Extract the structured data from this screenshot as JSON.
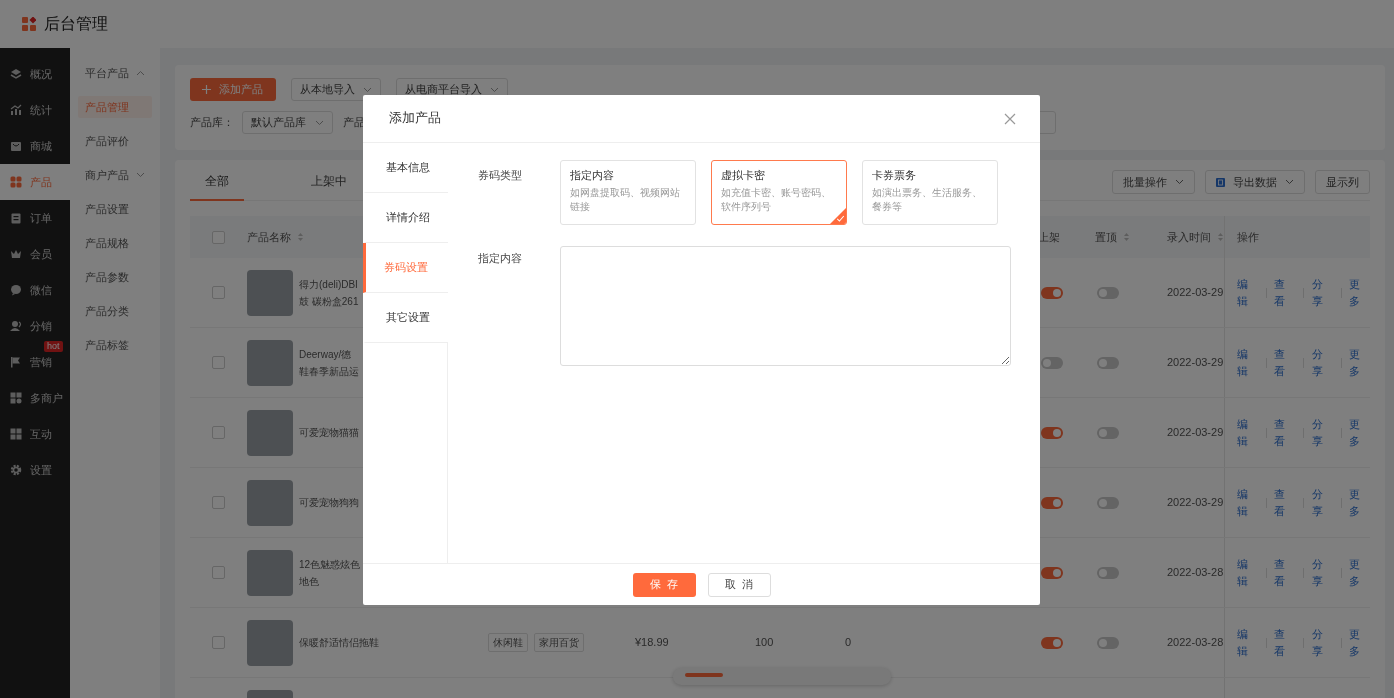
{
  "header": {
    "title": "后台管理"
  },
  "sidebar": {
    "items": [
      {
        "label": "概况",
        "selected": false
      },
      {
        "label": "统计",
        "selected": false
      },
      {
        "label": "商城",
        "selected": false
      },
      {
        "label": "产品",
        "selected": true
      },
      {
        "label": "订单",
        "selected": false
      },
      {
        "label": "会员",
        "selected": false
      },
      {
        "label": "微信",
        "selected": false
      },
      {
        "label": "分销",
        "selected": false
      },
      {
        "label": "营销",
        "selected": false,
        "badge": "hot"
      },
      {
        "label": "多商户",
        "selected": false
      },
      {
        "label": "互动",
        "selected": false
      },
      {
        "label": "设置",
        "selected": false
      }
    ]
  },
  "subnav": {
    "items": [
      {
        "label": "平台产品",
        "kind": "group",
        "expanded": true
      },
      {
        "label": "产品管理",
        "kind": "link",
        "selected": true
      },
      {
        "label": "产品评价",
        "kind": "link",
        "selected": false
      },
      {
        "label": "商户产品",
        "kind": "group",
        "expanded": false
      },
      {
        "label": "产品设置",
        "kind": "link",
        "selected": false
      },
      {
        "label": "产品规格",
        "kind": "link",
        "selected": false
      },
      {
        "label": "产品参数",
        "kind": "link",
        "selected": false
      },
      {
        "label": "产品分类",
        "kind": "link",
        "selected": false
      },
      {
        "label": "产品标签",
        "kind": "link",
        "selected": false
      }
    ]
  },
  "toolbar": {
    "add_button": "添加产品",
    "import_buttons": [
      "从本地导入",
      "从电商平台导入"
    ],
    "filters": [
      {
        "label": "产品库：",
        "value": "默认产品库"
      },
      {
        "label": "产品"
      }
    ]
  },
  "table": {
    "tabs": [
      {
        "label": "全部",
        "selected": true
      },
      {
        "label": "上架中",
        "selected": false
      }
    ],
    "actions": [
      "批量操作",
      "导出数据",
      "显示列"
    ],
    "select_all_checked": false,
    "columns": [
      {
        "label": "产品名称",
        "sortable": true
      },
      {
        "label": "上架",
        "sortable": false
      },
      {
        "label": "置顶",
        "sortable": true
      },
      {
        "label": "录入时间",
        "sortable": true
      },
      {
        "label": "操作",
        "sortable": false
      }
    ],
    "rows": [
      {
        "name_lines": [
          "得力(deli)DBI",
          "鼓 碳粉盒261"
        ],
        "checked": false,
        "on_shelf": true,
        "pinned": false,
        "date": "2022-03-29",
        "actions": [
          "编辑",
          "查看",
          "分享",
          "更多"
        ]
      },
      {
        "name_lines": [
          "Deerway/德",
          "鞋春季新品运"
        ],
        "checked": false,
        "on_shelf": false,
        "pinned": false,
        "date": "2022-03-29",
        "actions": [
          "编辑",
          "查看",
          "分享",
          "更多"
        ]
      },
      {
        "name_lines": [
          "可爱宠物猫猫"
        ],
        "checked": false,
        "on_shelf": true,
        "pinned": false,
        "date": "2022-03-29",
        "actions": [
          "编辑",
          "查看",
          "分享",
          "更多"
        ]
      },
      {
        "name_lines": [
          "可爱宠物狗狗"
        ],
        "checked": false,
        "on_shelf": true,
        "pinned": false,
        "date": "2022-03-29",
        "actions": [
          "编辑",
          "查看",
          "分享",
          "更多"
        ]
      },
      {
        "name_lines": [
          "12色魅惑炫色",
          "地色"
        ],
        "checked": false,
        "on_shelf": true,
        "pinned": false,
        "date": "2022-03-28",
        "actions": [
          "编辑",
          "查看",
          "分享",
          "更多"
        ]
      },
      {
        "name_lines": [
          "保暖舒适情侣拖鞋"
        ],
        "checked": false,
        "tags": [
          "休闲鞋",
          "家用百货"
        ],
        "price": "¥18.99",
        "stock": "100",
        "sales": "0",
        "on_shelf": true,
        "pinned": false,
        "date": "2022-03-28",
        "actions": [
          "编辑",
          "查看",
          "分享",
          "更多"
        ]
      },
      {}
    ]
  },
  "modal": {
    "title": "添加产品",
    "tabs": [
      {
        "label": "基本信息",
        "selected": false
      },
      {
        "label": "详情介绍",
        "selected": false
      },
      {
        "label": "券码设置",
        "selected": true
      },
      {
        "label": "其它设置",
        "selected": false
      }
    ],
    "type_label": "券码类型",
    "coupon_types": [
      {
        "title": "指定内容",
        "description": "如网盘提取码、视频网站链接",
        "selected": false
      },
      {
        "title": "虚拟卡密",
        "description": "如充值卡密、账号密码、软件序列号",
        "selected": true
      },
      {
        "title": "卡券票务",
        "description": "如演出票务、生活服务、餐券等",
        "selected": false
      }
    ],
    "content_label": "指定内容",
    "buttons": [
      {
        "label": "保存",
        "kind": "primary"
      },
      {
        "label": "取消",
        "kind": "default"
      }
    ]
  }
}
